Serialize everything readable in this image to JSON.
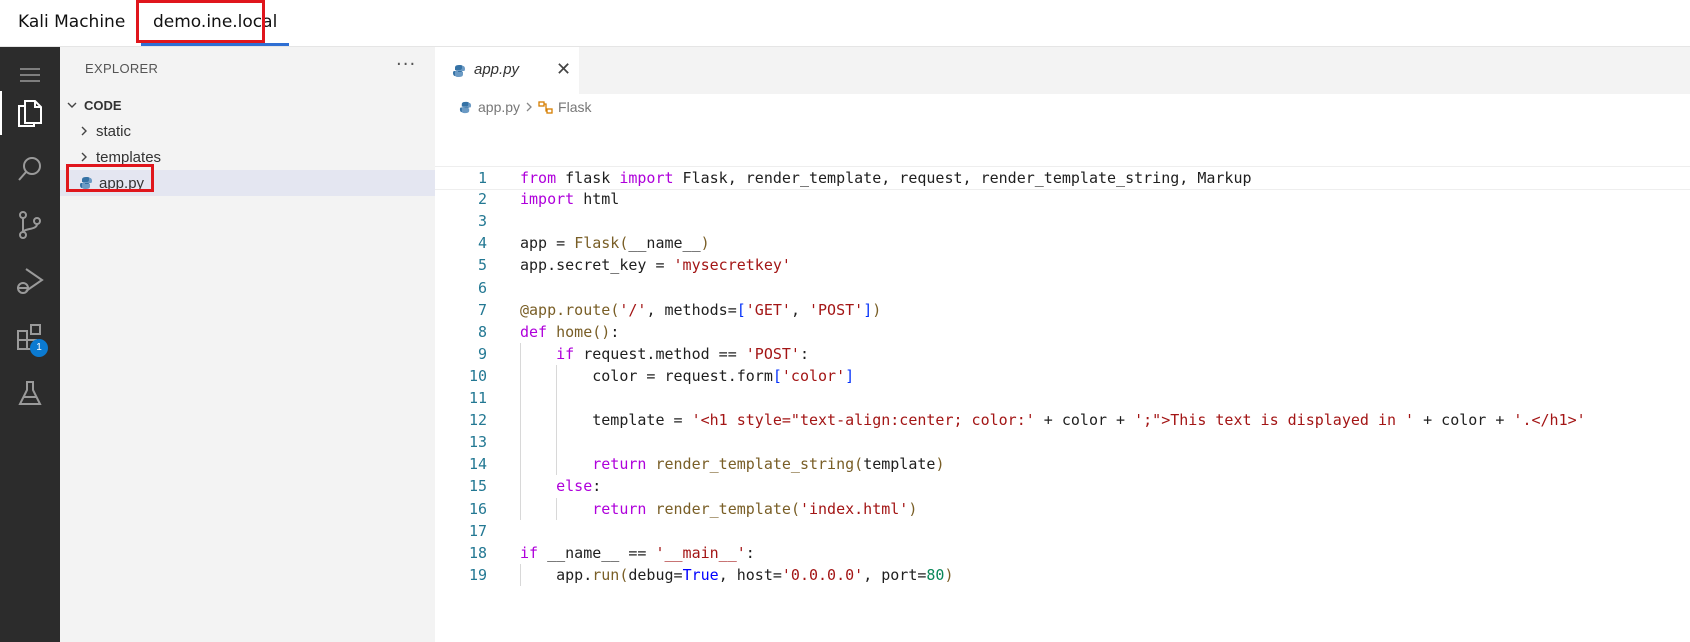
{
  "topbar": {
    "tabs": [
      {
        "label": "Kali Machine",
        "active": false
      },
      {
        "label": "demo.ine.local",
        "active": true
      }
    ]
  },
  "activitybar": {
    "items": [
      {
        "name": "menu-icon"
      },
      {
        "name": "explorer-icon",
        "active": true
      },
      {
        "name": "search-icon"
      },
      {
        "name": "source-control-icon"
      },
      {
        "name": "run-debug-icon"
      },
      {
        "name": "extensions-icon",
        "badge": "1"
      },
      {
        "name": "testing-icon"
      }
    ]
  },
  "explorer": {
    "title": "EXPLORER",
    "more": "···",
    "root": "CODE",
    "items": [
      {
        "label": "static",
        "type": "folder"
      },
      {
        "label": "templates",
        "type": "folder"
      },
      {
        "label": "app.py",
        "type": "file",
        "selected": true
      }
    ]
  },
  "editor": {
    "tab": {
      "label": "app.py",
      "close": "✕"
    },
    "breadcrumb": {
      "file": "app.py",
      "symbol": "Flask"
    },
    "lines": [
      "from flask import Flask, render_template, request, render_template_string, Markup",
      "import html",
      "",
      "app = Flask(__name__)",
      "app.secret_key = 'mysecretkey'",
      "",
      "@app.route('/', methods=['GET', 'POST'])",
      "def home():",
      "    if request.method == 'POST':",
      "        color = request.form['color']",
      "",
      "        template = '<h1 style=\"text-align:center; color:' + color + ';\">This text is displayed in ' + color + '.</h1>'",
      "",
      "        return render_template_string(template)",
      "    else:",
      "        return render_template('index.html')",
      "",
      "if __name__ == '__main__':",
      "    app.run(debug=True, host='0.0.0.0', port=80)"
    ]
  },
  "colors": {
    "keyword": "#af00db",
    "builtin": "#0000ff",
    "string": "#a31515",
    "function": "#795e26",
    "number": "#098658",
    "line_number": "#237893",
    "highlight_box": "#e0161c",
    "accent": "#2f6fd3"
  }
}
